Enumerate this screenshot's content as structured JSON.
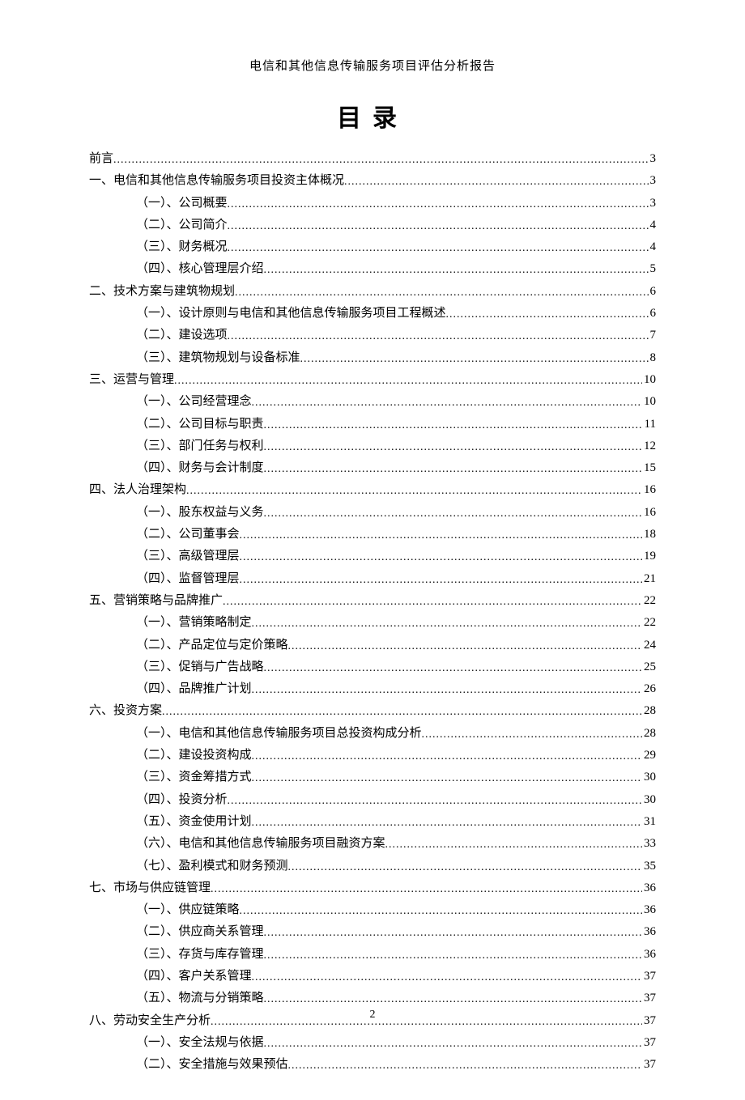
{
  "header": "电信和其他信息传输服务项目评估分析报告",
  "toc_title": "目录",
  "page_number": "2",
  "toc": [
    {
      "level": 1,
      "label": "前言",
      "page": "3"
    },
    {
      "level": 1,
      "label": "一、电信和其他信息传输服务项目投资主体概况",
      "page": "3"
    },
    {
      "level": 2,
      "label": "（一）、公司概要",
      "page": "3"
    },
    {
      "level": 2,
      "label": "（二）、公司简介",
      "page": "4"
    },
    {
      "level": 2,
      "label": "（三）、财务概况",
      "page": "4"
    },
    {
      "level": 2,
      "label": "（四）、核心管理层介绍",
      "page": "5"
    },
    {
      "level": 1,
      "label": "二、技术方案与建筑物规划",
      "page": "6"
    },
    {
      "level": 2,
      "label": "（一）、设计原则与电信和其他信息传输服务项目工程概述",
      "page": "6"
    },
    {
      "level": 2,
      "label": "（二）、建设选项",
      "page": "7"
    },
    {
      "level": 2,
      "label": "（三）、建筑物规划与设备标准",
      "page": "8"
    },
    {
      "level": 1,
      "label": "三、运营与管理",
      "page": "10"
    },
    {
      "level": 2,
      "label": "（一）、公司经营理念",
      "page": "10"
    },
    {
      "level": 2,
      "label": "（二）、公司目标与职责",
      "page": "11"
    },
    {
      "level": 2,
      "label": "（三）、部门任务与权利",
      "page": "12"
    },
    {
      "level": 2,
      "label": "（四）、财务与会计制度",
      "page": "15"
    },
    {
      "level": 1,
      "label": "四、法人治理架构",
      "page": "16"
    },
    {
      "level": 2,
      "label": "（一）、股东权益与义务",
      "page": "16"
    },
    {
      "level": 2,
      "label": "（二）、公司董事会",
      "page": "18"
    },
    {
      "level": 2,
      "label": "（三）、高级管理层",
      "page": "19"
    },
    {
      "level": 2,
      "label": "（四）、监督管理层",
      "page": "21"
    },
    {
      "level": 1,
      "label": "五、营销策略与品牌推广",
      "page": "22"
    },
    {
      "level": 2,
      "label": "（一）、营销策略制定",
      "page": "22"
    },
    {
      "level": 2,
      "label": "（二）、产品定位与定价策略",
      "page": "24"
    },
    {
      "level": 2,
      "label": "（三）、促销与广告战略",
      "page": "25"
    },
    {
      "level": 2,
      "label": "（四）、品牌推广计划",
      "page": "26"
    },
    {
      "level": 1,
      "label": "六、投资方案",
      "page": "28"
    },
    {
      "level": 2,
      "label": "（一）、电信和其他信息传输服务项目总投资构成分析",
      "page": "28"
    },
    {
      "level": 2,
      "label": "（二）、建设投资构成",
      "page": "29"
    },
    {
      "level": 2,
      "label": "（三）、资金筹措方式",
      "page": "30"
    },
    {
      "level": 2,
      "label": "（四）、投资分析",
      "page": "30"
    },
    {
      "level": 2,
      "label": "（五）、资金使用计划",
      "page": "31"
    },
    {
      "level": 2,
      "label": "（六）、电信和其他信息传输服务项目融资方案",
      "page": "33"
    },
    {
      "level": 2,
      "label": "（七）、盈利模式和财务预测",
      "page": "35"
    },
    {
      "level": 1,
      "label": "七、市场与供应链管理",
      "page": "36"
    },
    {
      "level": 2,
      "label": "（一）、供应链策略",
      "page": "36"
    },
    {
      "level": 2,
      "label": "（二）、供应商关系管理",
      "page": "36"
    },
    {
      "level": 2,
      "label": "（三）、存货与库存管理",
      "page": "36"
    },
    {
      "level": 2,
      "label": "（四）、客户关系管理",
      "page": "37"
    },
    {
      "level": 2,
      "label": "（五）、物流与分销策略",
      "page": "37"
    },
    {
      "level": 1,
      "label": "八、劳动安全生产分析",
      "page": "37"
    },
    {
      "level": 2,
      "label": "（一）、安全法规与依据",
      "page": "37"
    },
    {
      "level": 2,
      "label": "（二）、安全措施与效果预估",
      "page": "37"
    }
  ]
}
